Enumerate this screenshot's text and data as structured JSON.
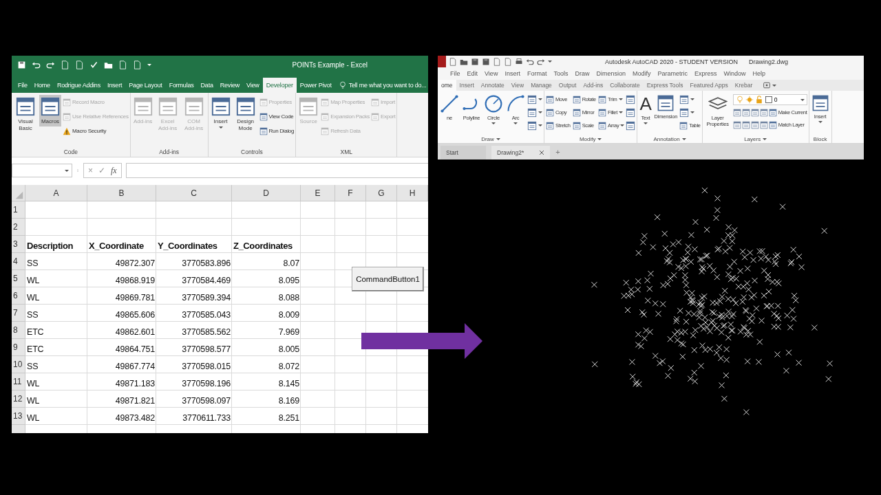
{
  "excel": {
    "title": "POINTs Example - Excel",
    "tabs": [
      {
        "label": "File",
        "selected": false
      },
      {
        "label": "Home",
        "selected": false
      },
      {
        "label": "Rodrigue Addins",
        "selected": false
      },
      {
        "label": "Insert",
        "selected": false
      },
      {
        "label": "Page Layout",
        "selected": false
      },
      {
        "label": "Formulas",
        "selected": false
      },
      {
        "label": "Data",
        "selected": false
      },
      {
        "label": "Review",
        "selected": false
      },
      {
        "label": "View",
        "selected": false
      },
      {
        "label": "Developer",
        "selected": true
      },
      {
        "label": "Power Pivot",
        "selected": false
      }
    ],
    "tell_me": "Tell me what you want to do...",
    "ribbon": [
      {
        "label": "Code",
        "items": [
          {
            "kind": "large",
            "label": "Visual Basic",
            "disabled": false,
            "pressed": false,
            "dropdown": false
          },
          {
            "kind": "large",
            "label": "Macros",
            "disabled": false,
            "pressed": true,
            "dropdown": false
          },
          {
            "kind": "stack",
            "items": [
              {
                "kind": "command",
                "label": "Record Macro",
                "disabled": true
              },
              {
                "kind": "command",
                "label": "Use Relative References",
                "disabled": true
              },
              {
                "kind": "warning",
                "label": "Macro Security",
                "disabled": false
              }
            ]
          }
        ]
      },
      {
        "label": "Add-ins",
        "items": [
          {
            "kind": "large",
            "label": "Add-ins",
            "disabled": true,
            "pressed": false,
            "dropdown": false
          },
          {
            "kind": "large",
            "label": "Excel Add-ins",
            "disabled": true,
            "pressed": false,
            "dropdown": false
          },
          {
            "kind": "large",
            "label": "COM Add-ins",
            "disabled": true,
            "pressed": false,
            "dropdown": false
          }
        ]
      },
      {
        "label": "Controls",
        "items": [
          {
            "kind": "large",
            "label": "Insert",
            "disabled": false,
            "pressed": false,
            "dropdown": true
          },
          {
            "kind": "large",
            "label": "Design Mode",
            "disabled": false,
            "pressed": false,
            "dropdown": false
          },
          {
            "kind": "stack",
            "items": [
              {
                "kind": "command",
                "label": "Properties",
                "disabled": true
              },
              {
                "kind": "command",
                "label": "View Code",
                "disabled": false
              },
              {
                "kind": "command",
                "label": "Run Dialog",
                "disabled": false
              }
            ]
          }
        ]
      },
      {
        "label": "XML",
        "items": [
          {
            "kind": "large",
            "label": "Source",
            "disabled": true,
            "pressed": false,
            "dropdown": false
          },
          {
            "kind": "stack",
            "items": [
              {
                "kind": "command",
                "label": "Map Properties",
                "disabled": true
              },
              {
                "kind": "command",
                "label": "Expansion Packs",
                "disabled": true
              },
              {
                "kind": "command",
                "label": "Refresh Data",
                "disabled": true
              }
            ]
          },
          {
            "kind": "stack",
            "items": [
              {
                "kind": "command",
                "label": "Import",
                "disabled": true
              },
              {
                "kind": "command",
                "label": "Export",
                "disabled": true
              }
            ]
          }
        ]
      }
    ],
    "formula_bar": {
      "cancel": "×",
      "enter": "✓",
      "function": "fx"
    },
    "columns": [
      "A",
      "B",
      "C",
      "D",
      "E",
      "F",
      "G",
      "H"
    ],
    "rows": [
      {
        "number": "1",
        "kind": "blank"
      },
      {
        "number": "2",
        "kind": "blank"
      },
      {
        "number": "3",
        "kind": "header",
        "cells": [
          "Description",
          "X_Coordinate",
          "Y_Coordinates",
          "Z_Coordinates"
        ]
      },
      {
        "number": "4",
        "kind": "data",
        "cells": [
          "SS",
          "49872.307",
          "3770583.896",
          "8.07"
        ]
      },
      {
        "number": "5",
        "kind": "data",
        "cells": [
          "WL",
          "49868.919",
          "3770584.469",
          "8.095"
        ]
      },
      {
        "number": "6",
        "kind": "data",
        "cells": [
          "WL",
          "49869.781",
          "3770589.394",
          "8.088"
        ]
      },
      {
        "number": "7",
        "kind": "data",
        "cells": [
          "SS",
          "49865.606",
          "3770585.043",
          "8.009"
        ]
      },
      {
        "number": "8",
        "kind": "data",
        "cells": [
          "ETC",
          "49862.601",
          "3770585.562",
          "7.969"
        ]
      },
      {
        "number": "9",
        "kind": "data",
        "cells": [
          "ETC",
          "49864.751",
          "3770598.577",
          "8.005"
        ]
      },
      {
        "number": "10",
        "kind": "data",
        "cells": [
          "SS",
          "49867.774",
          "3770598.015",
          "8.072"
        ]
      },
      {
        "number": "11",
        "kind": "data",
        "cells": [
          "WL",
          "49871.183",
          "3770598.196",
          "8.145"
        ]
      },
      {
        "number": "12",
        "kind": "data",
        "cells": [
          "WL",
          "49871.821",
          "3770598.097",
          "8.169"
        ]
      },
      {
        "number": "13",
        "kind": "data",
        "cells": [
          "WL",
          "49873.482",
          "3770611.733",
          "8.251"
        ]
      }
    ],
    "command_button": "CommandButton1"
  },
  "autocad": {
    "title": "Autodesk AutoCAD 2020 - STUDENT VERSION",
    "file": "Drawing2.dwg",
    "menu": [
      "File",
      "Edit",
      "View",
      "Insert",
      "Format",
      "Tools",
      "Draw",
      "Dimension",
      "Modify",
      "Parametric",
      "Express",
      "Window",
      "Help"
    ],
    "ribbon_tabs": [
      {
        "label": "ome",
        "selected": true
      },
      {
        "label": "Insert",
        "selected": false
      },
      {
        "label": "Annotate",
        "selected": false
      },
      {
        "label": "View",
        "selected": false
      },
      {
        "label": "Manage",
        "selected": false
      },
      {
        "label": "Output",
        "selected": false
      },
      {
        "label": "Add-ins",
        "selected": false
      },
      {
        "label": "Collaborate",
        "selected": false
      },
      {
        "label": "Express Tools",
        "selected": false
      },
      {
        "label": "Featured Apps",
        "selected": false
      },
      {
        "label": "Krebar",
        "selected": false
      }
    ],
    "ribbon": [
      {
        "label": "Draw",
        "dropdown": true,
        "items": [
          {
            "kind": "large",
            "label": "ne",
            "dropdown": false
          },
          {
            "kind": "large",
            "label": "Polyline",
            "dropdown": false
          },
          {
            "kind": "large",
            "label": "Circle",
            "dropdown": true
          },
          {
            "kind": "large",
            "label": "Arc",
            "dropdown": true
          },
          {
            "kind": "stack",
            "items": [
              {
                "kind": "command",
                "dropdown": true
              },
              {
                "kind": "command",
                "dropdown": true
              },
              {
                "kind": "command",
                "dropdown": true
              }
            ]
          }
        ]
      },
      {
        "label": "Modify",
        "dropdown": true,
        "items": [
          {
            "kind": "grid",
            "items": [
              {
                "kind": "command",
                "label": "Move",
                "dropdown": false
              },
              {
                "kind": "command",
                "label": "Rotate",
                "dropdown": false
              },
              {
                "kind": "command",
                "label": "Trim",
                "dropdown": true
              },
              {
                "kind": "command",
                "label": "Copy",
                "dropdown": false
              },
              {
                "kind": "command",
                "label": "Mirror",
                "dropdown": false
              },
              {
                "kind": "command",
                "label": "Fillet",
                "dropdown": true
              },
              {
                "kind": "command",
                "label": "Stretch",
                "dropdown": false
              },
              {
                "kind": "command",
                "label": "Scale",
                "dropdown": false
              },
              {
                "kind": "command",
                "label": "Array",
                "dropdown": true
              }
            ]
          },
          {
            "kind": "stack",
            "items": [
              {
                "kind": "command",
                "dropdown": false
              },
              {
                "kind": "command",
                "dropdown": false
              },
              {
                "kind": "command",
                "dropdown": false
              }
            ]
          }
        ]
      },
      {
        "label": "Annotation",
        "dropdown": true,
        "items": [
          {
            "kind": "large",
            "label": "Text",
            "glyph": "A",
            "dropdown": true
          },
          {
            "kind": "large",
            "label": "Dimension",
            "dropdown": false
          },
          {
            "kind": "stack",
            "items": [
              {
                "kind": "command",
                "dropdown": true
              },
              {
                "kind": "command",
                "dropdown": true
              },
              {
                "kind": "command",
                "label": "Table",
                "dropdown": false
              }
            ]
          }
        ]
      },
      {
        "label": "Layers",
        "dropdown": true,
        "items": [
          {
            "kind": "large",
            "label": "Layer Properties",
            "dropdown": false
          },
          {
            "kind": "layers",
            "layer": "0",
            "commands": [
              "Make Current",
              "Match Layer"
            ]
          }
        ]
      },
      {
        "label": "Block",
        "dropdown": false,
        "items": [
          {
            "kind": "large",
            "label": "Insert",
            "dropdown": true
          }
        ]
      }
    ],
    "doc_tabs": [
      {
        "label": "Start",
        "selected": false,
        "closable": false
      },
      {
        "label": "Drawing2*",
        "selected": true,
        "closable": true
      }
    ],
    "new_tab": "+"
  }
}
